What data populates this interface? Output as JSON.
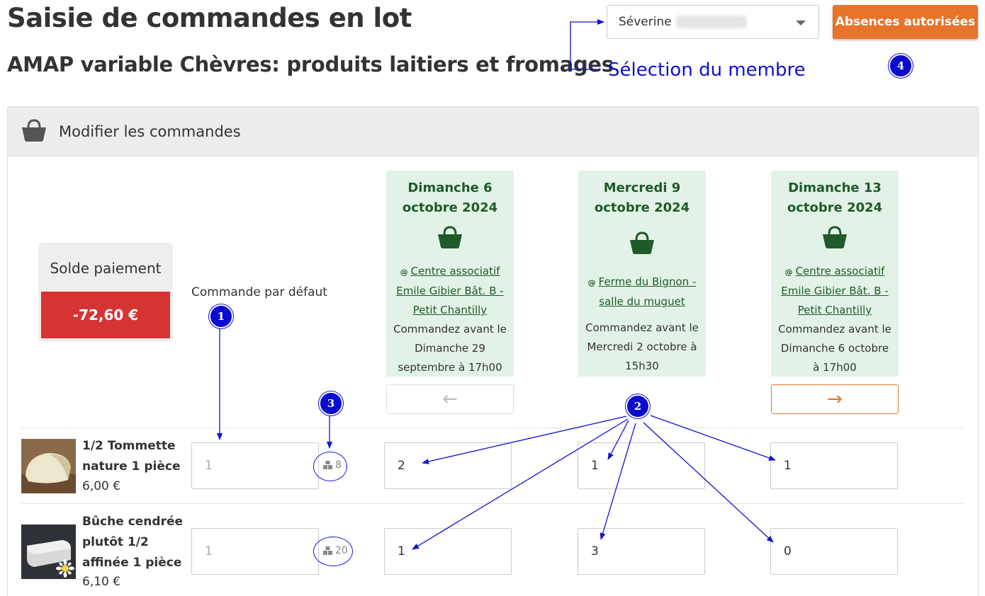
{
  "header": {
    "title": "Saisie de commandes en lot",
    "subtitle": "AMAP variable Chèvres: produits laitiers et fromages"
  },
  "member_select": {
    "value": "Séverine"
  },
  "absences_button": "Absences autorisées",
  "annotations": {
    "member_label": "Sélection du membre",
    "markers": [
      "1",
      "2",
      "3",
      "4"
    ]
  },
  "panel": {
    "title": "Modifier les commandes"
  },
  "balance": {
    "label": "Solde paiement",
    "amount": "-72,60 €"
  },
  "default_order_label": "Commande par défaut",
  "dates": [
    {
      "title": "Dimanche 6 octobre 2024",
      "location": "Centre associatif Emile Gibier Bât. B - Petit Chantilly",
      "deadline": "Commandez avant le Dimanche 29 septembre à 17h00"
    },
    {
      "title": "Mercredi 9 octobre 2024",
      "location": "Ferme du Bignon - salle du muguet",
      "deadline": "Commandez avant le Mercredi 2 octobre à 15h30"
    },
    {
      "title": "Dimanche 13 octobre 2024",
      "location": "Centre associatif Emile Gibier Bât. B - Petit Chantilly",
      "deadline": "Commandez avant le Dimanche 6 octobre à 17h00"
    }
  ],
  "nav": {
    "prev": "←",
    "next": "→"
  },
  "products": [
    {
      "name": "1/2 Tommette nature 1 pièce",
      "price": "6,00 €",
      "default_qty": "1",
      "stock": "8",
      "quantities": [
        "2",
        "1",
        "1"
      ]
    },
    {
      "name": "Bûche cendrée plutôt 1/2 affinée 1 pièce",
      "price": "6,10 €",
      "default_qty": "1",
      "stock": "20",
      "quantities": [
        "1",
        "3",
        "0"
      ]
    }
  ],
  "colors": {
    "accent_orange": "#e8732a",
    "balance_red": "#d63333",
    "date_card_bg": "#e3f2e6",
    "date_green": "#1e5a2a",
    "annotation_blue": "#1010d0"
  },
  "icons": {
    "panel": "shopping-basket-icon",
    "date": "shopping-basket-icon",
    "stock": "stock-boxes-icon",
    "select": "chevron-down-icon"
  }
}
